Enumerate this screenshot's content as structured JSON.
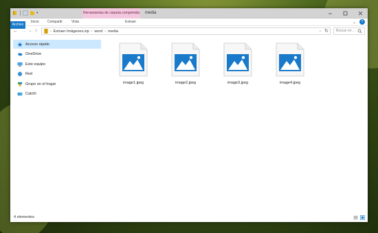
{
  "titlebar": {
    "context_tab": "Herramientas de carpeta comprimida",
    "title": "media"
  },
  "ribbon": {
    "tabs": [
      "Archivo",
      "Inicio",
      "Compartir",
      "Vista"
    ],
    "extract_tab": "Extraer"
  },
  "address": {
    "segments": [
      "Extraer Imágenes.zip",
      "word",
      "media"
    ],
    "search_placeholder": "Buscar en ..."
  },
  "sidebar": {
    "items": [
      {
        "label": "Acceso rápido",
        "icon": "star-icon"
      },
      {
        "label": "OneDrive",
        "icon": "cloud-icon"
      },
      {
        "label": "Este equipo",
        "icon": "computer-icon"
      },
      {
        "label": "Red",
        "icon": "network-icon"
      },
      {
        "label": "Grupo en el hogar",
        "icon": "homegroup-icon"
      },
      {
        "label": "Catchl",
        "icon": "drive-icon"
      }
    ]
  },
  "files": [
    {
      "name": "image1.jpeg",
      "icon": "image-file-icon"
    },
    {
      "name": "image2.jpeg",
      "icon": "image-file-icon"
    },
    {
      "name": "image3.jpeg",
      "icon": "image-file-icon"
    },
    {
      "name": "image4.jpeg",
      "icon": "image-file-icon"
    }
  ],
  "status": {
    "count": "4 elementos"
  },
  "colors": {
    "accent": "#1979ca",
    "context_tab": "#f3c7dd",
    "selection": "#cce8ff"
  }
}
